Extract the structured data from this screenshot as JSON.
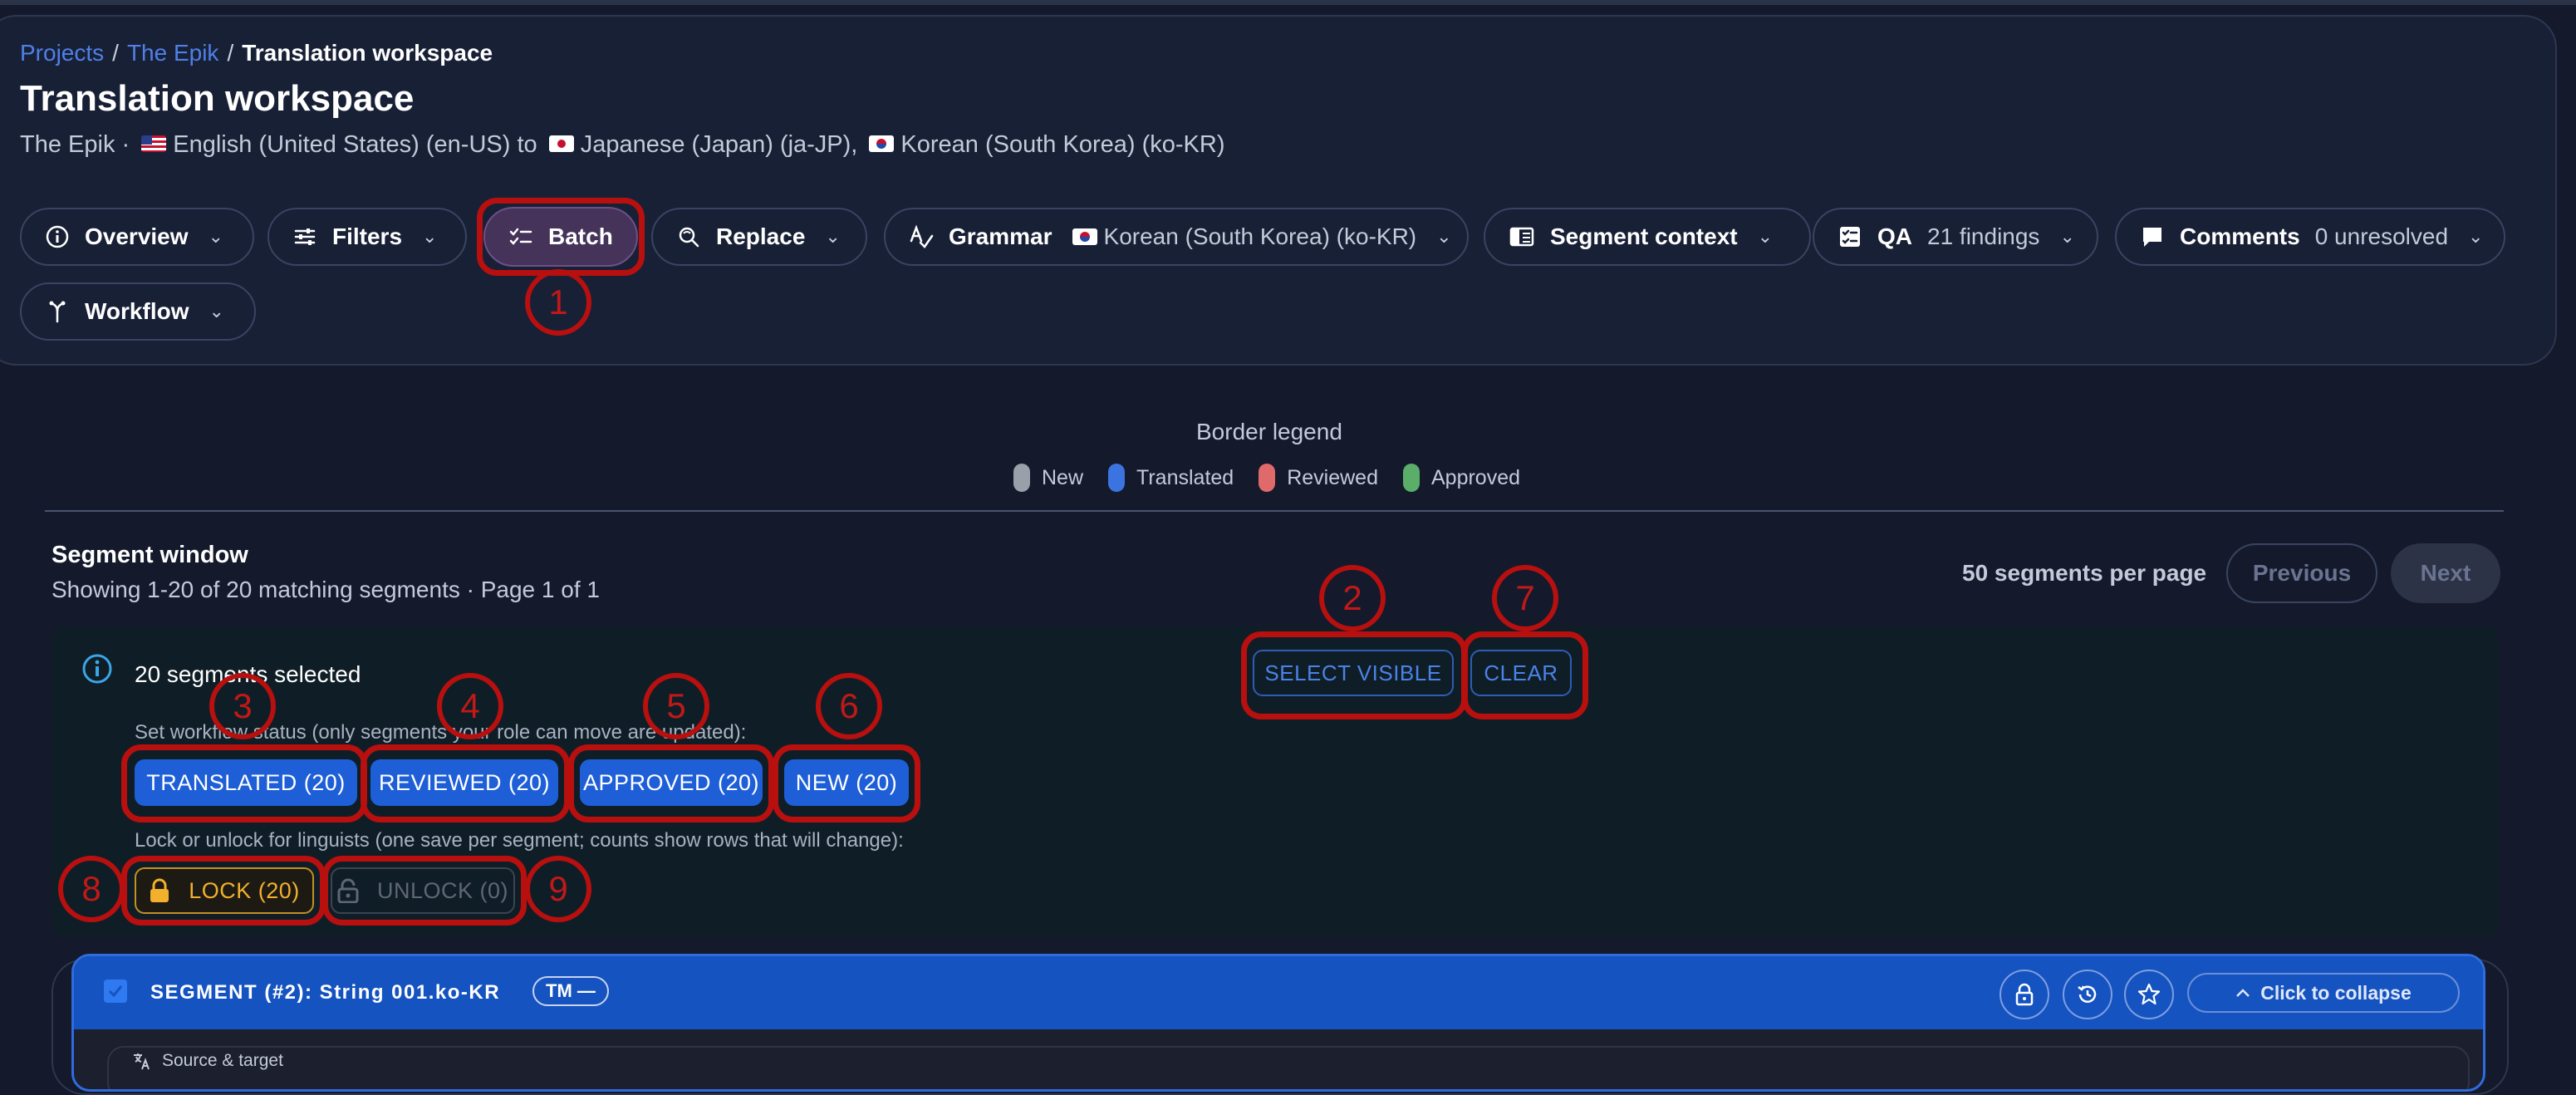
{
  "breadcrumb": {
    "projects": "Projects",
    "project": "The Epik",
    "current": "Translation workspace"
  },
  "page": {
    "title": "Translation workspace",
    "subtitle_project": "The Epik ·",
    "lang_source": "English (United States) (en-US) to",
    "lang_target_1": "Japanese (Japan) (ja-JP),",
    "lang_target_2": "Korean (South Korea) (ko-KR)"
  },
  "toolbar": {
    "overview": "Overview",
    "filters": "Filters",
    "batch": "Batch",
    "replace": "Replace",
    "grammar": "Grammar",
    "grammar_lang": "Korean (South Korea) (ko-KR)",
    "segment_context": "Segment context",
    "qa": "QA",
    "qa_count": "21 findings",
    "comments": "Comments",
    "comments_count": "0 unresolved",
    "workflow": "Workflow"
  },
  "legend": {
    "title": "Border legend",
    "items": [
      {
        "label": "New",
        "color": "#9aa0aa"
      },
      {
        "label": "Translated",
        "color": "#3b74e0"
      },
      {
        "label": "Reviewed",
        "color": "#e06a6a"
      },
      {
        "label": "Approved",
        "color": "#5aae6a"
      }
    ]
  },
  "segment_window": {
    "title": "Segment window",
    "subtitle": "Showing 1-20 of 20 matching segments · Page 1 of 1",
    "per_page": "50 segments per page",
    "previous": "Previous",
    "next": "Next"
  },
  "selection": {
    "count_text": "20 segments selected",
    "select_visible": "SELECT VISIBLE",
    "clear": "CLEAR",
    "workflow_label": "Set workflow status (only segments your role can move are updated):",
    "translated": "TRANSLATED (20)",
    "reviewed": "REVIEWED (20)",
    "approved": "APPROVED (20)",
    "new": "NEW (20)",
    "lock_label": "Lock or unlock for linguists (one save per segment; counts show rows that will change):",
    "lock": "LOCK (20)",
    "unlock": "UNLOCK (0)"
  },
  "segment": {
    "title": "SEGMENT (#2): String 001.ko-KR",
    "tm_badge": "TM —",
    "collapse": "Click to collapse",
    "source_target": "Source & target"
  },
  "annotations": [
    "1",
    "2",
    "3",
    "4",
    "5",
    "6",
    "7",
    "8",
    "9"
  ],
  "colors": {
    "accent": "#1e5fd8",
    "annotation": "#b80f0f",
    "lock": "#f2b02c"
  }
}
